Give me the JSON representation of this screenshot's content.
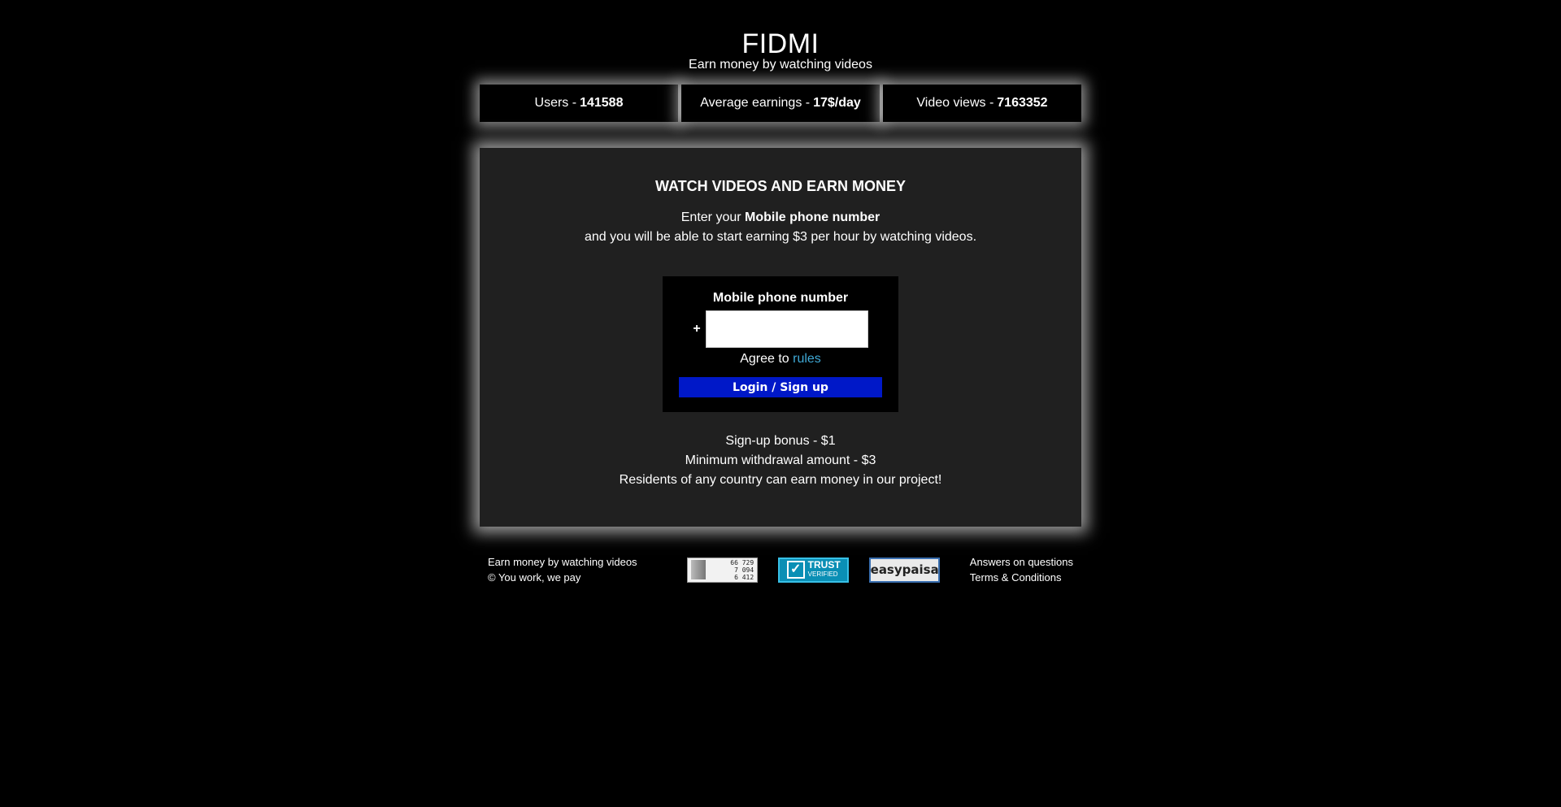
{
  "header": {
    "title": "FIDMI",
    "subtitle": "Earn money by watching videos"
  },
  "stats": [
    {
      "label": "Users -",
      "value": "141588"
    },
    {
      "label": "Average earnings -",
      "value": "17$/day"
    },
    {
      "label": "Video views -",
      "value": "7163352"
    }
  ],
  "main": {
    "heading": "WATCH VIDEOS AND EARN MONEY",
    "intro_prefix": "Enter your",
    "intro_bold": "Mobile phone number",
    "intro_line2": "and you will be able to start earning $3 per hour by watching videos.",
    "form": {
      "label": "Mobile phone number",
      "plus": "+",
      "phone_value": "",
      "agree_prefix": "Agree to",
      "rules_link": "rules",
      "submit_label": "Login / Sign up"
    },
    "info": [
      "Sign-up bonus - $1",
      "Minimum withdrawal amount - $3",
      "Residents of any country can earn money in our project!"
    ]
  },
  "footer": {
    "left_line1": "Earn money by watching videos",
    "left_line2": "© You work, we pay",
    "badges": {
      "counter": [
        "66 729",
        "7 094",
        "6 412"
      ],
      "trust_title": "TRUST",
      "trust_sub": "VERIFIED",
      "easypaisa": "easypaisa"
    },
    "links": [
      "Answers on questions",
      "Terms & Conditions"
    ]
  },
  "colors": {
    "background": "#000000",
    "panel": "#202020",
    "button": "#0018c8",
    "link": "#3fa9d6"
  }
}
